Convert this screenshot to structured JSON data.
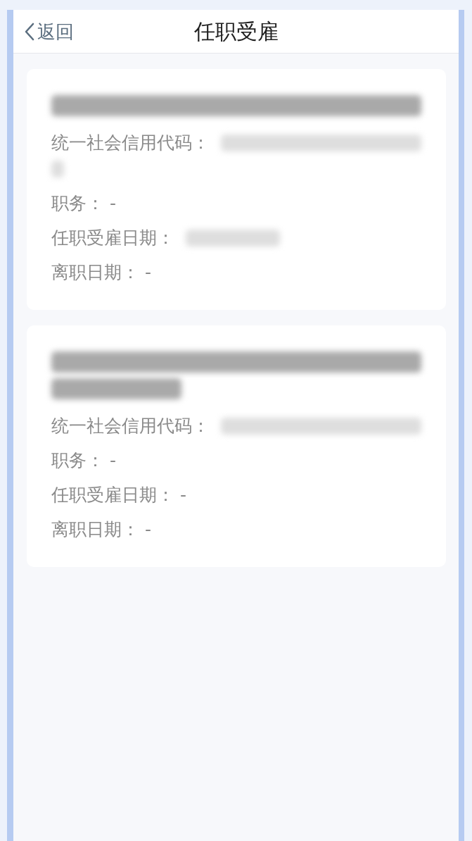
{
  "header": {
    "back": {
      "label": "返回"
    },
    "title": "任职受雇"
  },
  "records": [
    {
      "name": {
        "kind": "blurred"
      },
      "fields": [
        {
          "kind": "blurred_wrapped",
          "label": "统一社会信用代码："
        },
        {
          "kind": "text",
          "text": "职务： -"
        },
        {
          "kind": "blurred_short",
          "label": "任职受雇日期："
        },
        {
          "kind": "text",
          "text": "离职日期： -"
        }
      ]
    },
    {
      "name": {
        "kind": "blurred_wrapped"
      },
      "fields": [
        {
          "kind": "blurred",
          "label": "统一社会信用代码："
        },
        {
          "kind": "text",
          "text": "职务： -"
        },
        {
          "kind": "text",
          "text": "任职受雇日期： -"
        },
        {
          "kind": "text",
          "text": "离职日期： -"
        }
      ]
    }
  ]
}
